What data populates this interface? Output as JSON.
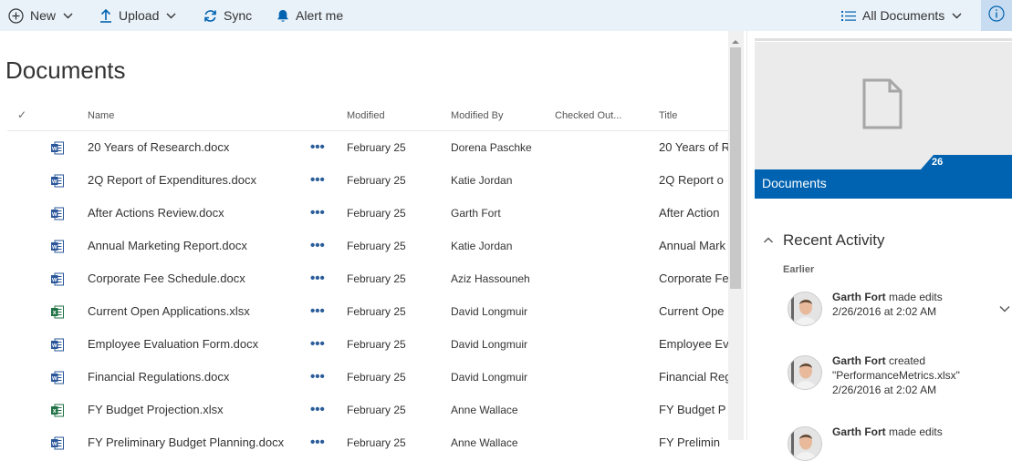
{
  "toolbar": {
    "new_label": "New",
    "upload_label": "Upload",
    "sync_label": "Sync",
    "alert_label": "Alert me",
    "view_label": "All Documents"
  },
  "main": {
    "title": "Documents",
    "columns": {
      "name": "Name",
      "modified": "Modified",
      "modified_by": "Modified By",
      "checked_out": "Checked Out...",
      "title": "Title"
    },
    "rows": [
      {
        "type": "word",
        "name": "20 Years of Research.docx",
        "modified": "February 25",
        "modified_by": "Dorena Paschke",
        "title": "20 Years of R"
      },
      {
        "type": "word",
        "name": "2Q Report of Expenditures.docx",
        "modified": "February 25",
        "modified_by": "Katie Jordan",
        "title": "2Q Report o"
      },
      {
        "type": "word",
        "name": "After Actions Review.docx",
        "modified": "February 25",
        "modified_by": "Garth Fort",
        "title": "After Action"
      },
      {
        "type": "word",
        "name": "Annual Marketing Report.docx",
        "modified": "February 25",
        "modified_by": "Katie Jordan",
        "title": "Annual Mark"
      },
      {
        "type": "word",
        "name": "Corporate Fee Schedule.docx",
        "modified": "February 25",
        "modified_by": "Aziz Hassouneh",
        "title": "Corporate Fe"
      },
      {
        "type": "excel",
        "name": "Current Open Applications.xlsx",
        "modified": "February 25",
        "modified_by": "David Longmuir",
        "title": "Current Ope"
      },
      {
        "type": "word",
        "name": "Employee Evaluation Form.docx",
        "modified": "February 25",
        "modified_by": "David Longmuir",
        "title": "Employee Ev"
      },
      {
        "type": "word",
        "name": "Financial Regulations.docx",
        "modified": "February 25",
        "modified_by": "David Longmuir",
        "title": "Financial Reg"
      },
      {
        "type": "excel",
        "name": "FY Budget Projection.xlsx",
        "modified": "February 25",
        "modified_by": "Anne Wallace",
        "title": "FY Budget P"
      },
      {
        "type": "word",
        "name": "FY Preliminary Budget Planning.docx",
        "modified": "February 25",
        "modified_by": "Anne Wallace",
        "title": "FY Prelimin"
      }
    ],
    "more_glyph": "•••"
  },
  "panel": {
    "library_label": "Documents",
    "item_count": "26",
    "recent_title": "Recent Activity",
    "group_label": "Earlier",
    "activities": [
      {
        "user": "Garth Fort",
        "action": " made edits",
        "detail": "",
        "time": "2/26/2016 at 2:02 AM"
      },
      {
        "user": "Garth Fort",
        "action": " created",
        "detail": "\"PerformanceMetrics.xlsx\"",
        "time": "2/26/2016 at 2:02 AM"
      },
      {
        "user": "Garth Fort",
        "action": " made edits",
        "detail": "",
        "time": ""
      }
    ]
  },
  "colors": {
    "accent": "#0063b1",
    "bar_bg": "#e9f1f9",
    "word": "#2b579a",
    "excel": "#217346"
  }
}
